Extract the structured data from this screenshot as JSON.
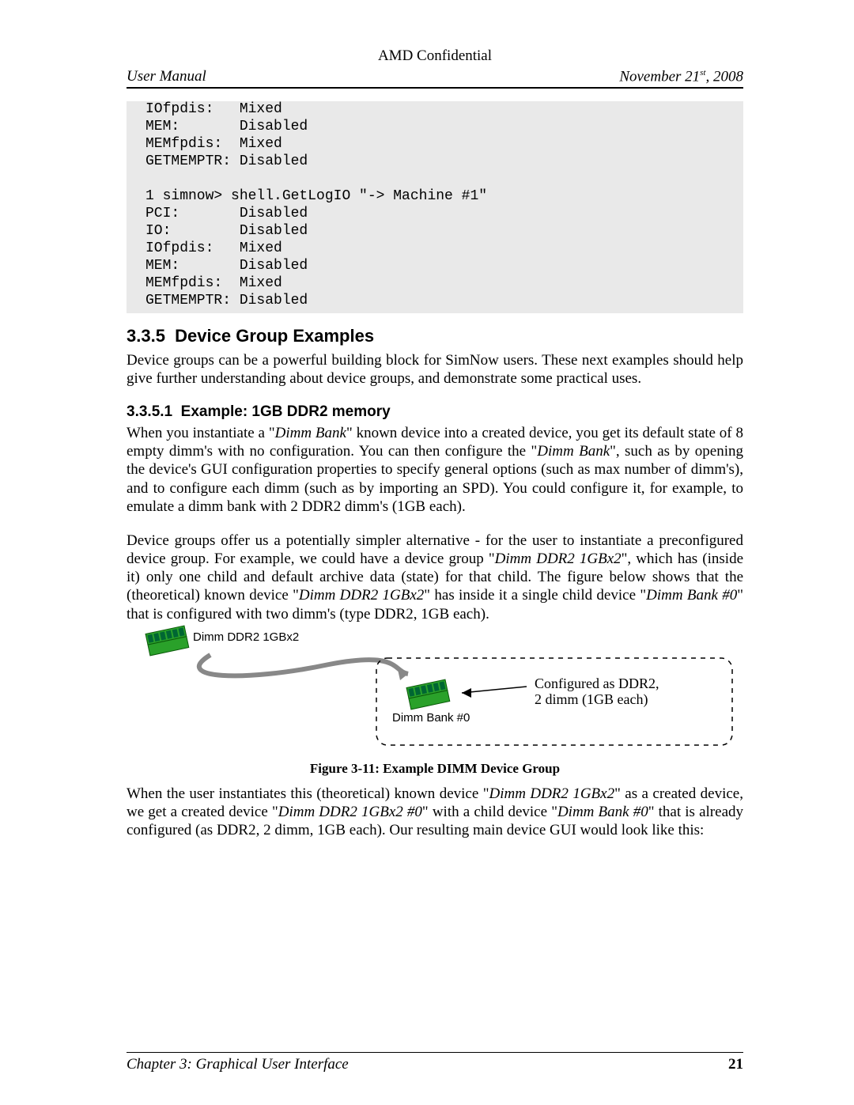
{
  "header": {
    "classification": "AMD Confidential",
    "left": "User Manual",
    "right_prefix": "November 21",
    "right_suffix": ", 2008",
    "right_sup": "st"
  },
  "code": {
    "lines": [
      "IOfpdis:   Mixed",
      "MEM:       Disabled",
      "MEMfpdis:  Mixed",
      "GETMEMPTR: Disabled",
      "",
      "1 simnow> shell.GetLogIO \"-> Machine #1\"",
      "PCI:       Disabled",
      "IO:        Disabled",
      "IOfpdis:   Mixed",
      "MEM:       Disabled",
      "MEMfpdis:  Mixed",
      "GETMEMPTR: Disabled"
    ]
  },
  "section": {
    "num": "3.3.5",
    "title": "Device Group Examples",
    "intro": "Device groups can be a powerful building block for SimNow users. These next examples should help give further understanding about device groups, and demonstrate some practical uses."
  },
  "subsection": {
    "num": "3.3.5.1",
    "title": "Example: 1GB DDR2 memory",
    "para1": {
      "a": "When you instantiate a \"",
      "dimm_bank1": "Dimm Bank",
      "b": "\" known device into a created device, you get its default state of 8 empty dimm's with no configuration. You can then configure the \"",
      "dimm_bank2": "Dimm Bank",
      "c": "\", such as by opening the device's GUI configuration properties to specify general options (such as max number of dimm's), and to configure each dimm (such as by importing an SPD). You could configure it, for example, to emulate a dimm bank with 2 DDR2 dimm's (1GB each)."
    },
    "para2": {
      "a": "Device groups offer us a potentially simpler alternative - for the user to instantiate a preconfigured device group. For example, we could have a device group \"",
      "d1": "Dimm DDR2 1GBx2",
      "b": "\", which has (inside it) only one child and default archive data (state) for that child. The figure below shows that the (theoretical) known device \"",
      "d2": "Dimm DDR2 1GBx2",
      "c": "\" has inside it a single child device \"",
      "d3": "Dimm Bank #0",
      "d": "\" that is configured with two dimm's (type DDR2, 1GB each)."
    },
    "para3": {
      "a": "When the user instantiates this (theoretical) known device \"",
      "d1": "Dimm DDR2 1GBx2",
      "b": "\" as a created device, we get a created device \"",
      "d2": "Dimm DDR2 1GBx2 #0",
      "c": "\" with a child device \"",
      "d3": "Dimm Bank #0",
      "d": "\" that is already configured (as DDR2, 2 dimm, 1GB each). Our resulting main device GUI would look like this:"
    }
  },
  "figure": {
    "left_label": "Dimm DDR2 1GBx2",
    "child_label": "Dimm Bank #0",
    "note_line1": "Configured as DDR2,",
    "note_line2": "2 dimm (1GB each)",
    "caption": "Figure 3-11: Example DIMM Device Group"
  },
  "footer": {
    "chapter": "Chapter 3: Graphical User Interface",
    "page": "21"
  }
}
